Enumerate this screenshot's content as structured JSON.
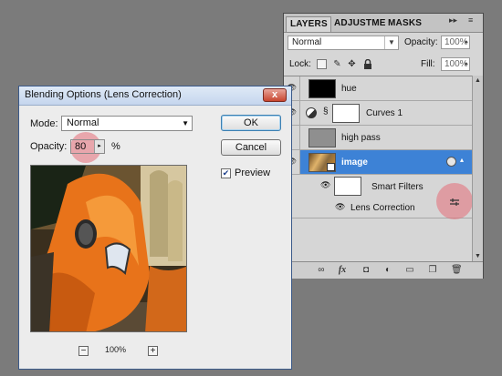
{
  "layers_panel": {
    "tabs": [
      "LAYERS",
      "ADJUSTMEI",
      "MASKS"
    ],
    "tab_controls": [
      "▸▸",
      "≡"
    ],
    "blend_mode": "Normal",
    "opacity_label": "Opacity:",
    "opacity_value": "100%",
    "lock_label": "Lock:",
    "fill_label": "Fill:",
    "fill_value": "100%",
    "layers": [
      {
        "name": "hue"
      },
      {
        "name": "Curves 1"
      },
      {
        "name": "high pass"
      },
      {
        "name": "image",
        "selected": true
      },
      {
        "name": "Smart Filters"
      },
      {
        "name": "Lens Correction"
      }
    ],
    "bottom_icons": [
      "link-icon",
      "fx-icon",
      "mask-icon",
      "adjustment-icon",
      "folder-icon",
      "new-layer-icon",
      "trash-icon"
    ],
    "selected_color": "#3d82d6"
  },
  "dialog": {
    "title": "Blending Options (Lens Correction)",
    "close_label": "x",
    "mode_label": "Mode:",
    "mode_value": "Normal",
    "opacity_label": "Opacity:",
    "opacity_value": "80",
    "opacity_unit": "%",
    "ok_label": "OK",
    "cancel_label": "Cancel",
    "preview_label": "Preview",
    "preview_checked": true,
    "zoom_minus": "−",
    "zoom_plus": "+",
    "zoom_value": "100%"
  }
}
